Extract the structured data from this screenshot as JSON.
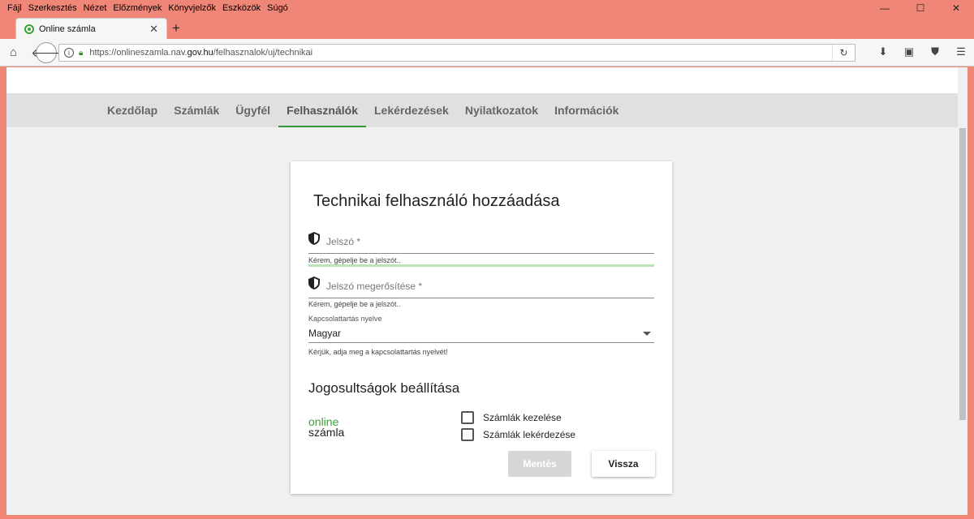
{
  "menubar": {
    "items": [
      "Fájl",
      "Szerkesztés",
      "Nézet",
      "Előzmények",
      "Könyvjelzők",
      "Eszközök",
      "Súgó"
    ]
  },
  "window_controls": {
    "minimize": "—",
    "maximize": "☐",
    "close": "✕"
  },
  "tab": {
    "title": "Online számla",
    "close": "✕",
    "new_tab": "+"
  },
  "urlbar": {
    "prefix": "https://onlineszamla.nav.",
    "domain": "gov.hu",
    "path": "/felhasznalok/uj/technikai"
  },
  "appnav": {
    "items": [
      "Kezdőlap",
      "Számlák",
      "Ügyfél",
      "Felhasználók",
      "Lekérdezések",
      "Nyilatkozatok",
      "Információk"
    ],
    "active": "Felhasználók"
  },
  "form": {
    "title": "Technikai felhasználó hozzáadása",
    "password_label": "Jelszó *",
    "password_hint": "Kérem, gépelje be a jelszót..",
    "confirm_label": "Jelszó megerősítése *",
    "confirm_hint": "Kérem, gépelje be a jelszót..",
    "language_label": "Kapcsolattartás nyelve",
    "language_value": "Magyar",
    "language_hint": "Kérjük, adja meg a kapcsolattartás nyelvét!",
    "permissions_title": "Jogosultságok beállítása",
    "logo_top": "online",
    "logo_bottom": "számla",
    "perm_invoices": "Számlák kezelése",
    "perm_queries": "Számlák lekérdezése",
    "save_label": "Mentés",
    "back_label": "Vissza"
  },
  "colors": {
    "accent": "#2e9a3a",
    "titlebar": "#f08677",
    "page_bg": "#f1f1f1"
  }
}
